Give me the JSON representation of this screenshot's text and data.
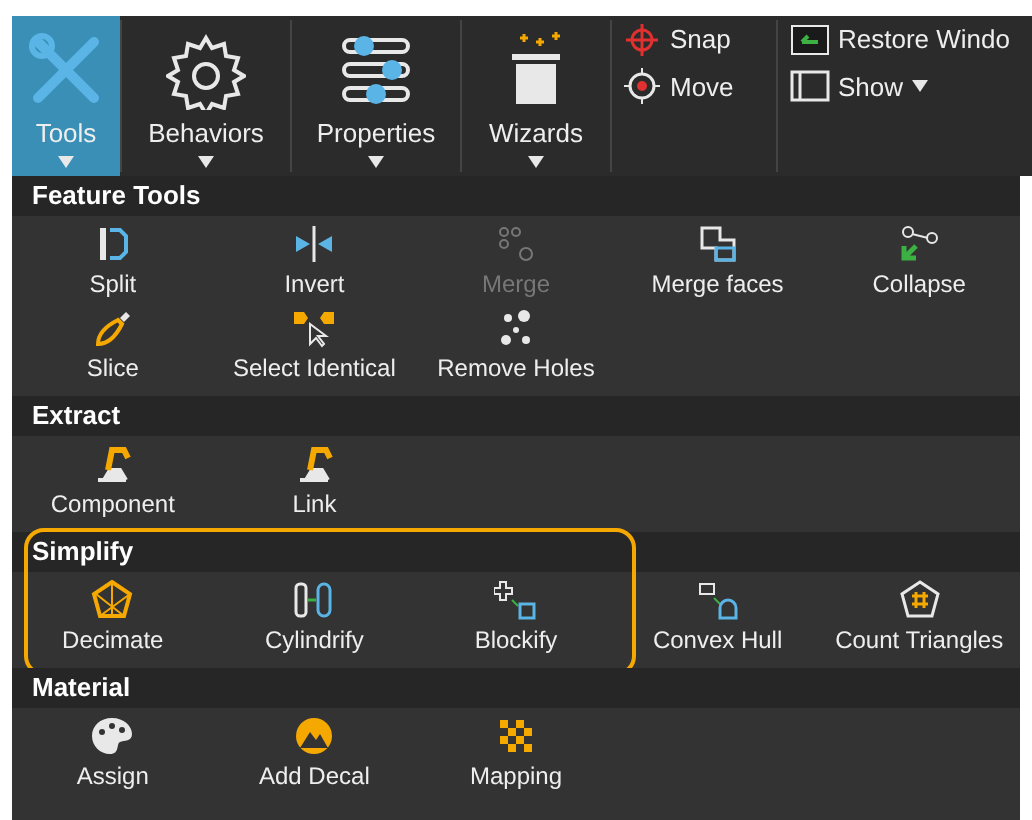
{
  "ribbon": {
    "large_buttons": [
      {
        "label": "Tools",
        "selected": true
      },
      {
        "label": "Behaviors",
        "selected": false
      },
      {
        "label": "Properties",
        "selected": false
      },
      {
        "label": "Wizards",
        "selected": false
      }
    ],
    "small_buttons": [
      {
        "label": "Snap",
        "kind": "plain"
      },
      {
        "label": "Move",
        "kind": "plain"
      },
      {
        "label": "Restore Windo",
        "kind": "plain"
      },
      {
        "label": "Show",
        "kind": "dropdown"
      }
    ]
  },
  "sections": [
    {
      "title": "Feature Tools",
      "items": [
        {
          "label": "Split",
          "disabled": false,
          "highlighted": false
        },
        {
          "label": "Invert",
          "disabled": false,
          "highlighted": false
        },
        {
          "label": "Merge",
          "disabled": true,
          "highlighted": false
        },
        {
          "label": "Merge faces",
          "disabled": false,
          "highlighted": false
        },
        {
          "label": "Collapse",
          "disabled": false,
          "highlighted": false
        },
        {
          "label": "Slice",
          "disabled": false,
          "highlighted": false
        },
        {
          "label": "Select Identical",
          "disabled": false,
          "highlighted": false
        },
        {
          "label": "Remove Holes",
          "disabled": false,
          "highlighted": false
        }
      ]
    },
    {
      "title": "Extract",
      "items": [
        {
          "label": "Component",
          "disabled": false,
          "highlighted": false
        },
        {
          "label": "Link",
          "disabled": false,
          "highlighted": false
        }
      ]
    },
    {
      "title": "Simplify",
      "items": [
        {
          "label": "Decimate",
          "disabled": false,
          "highlighted": true
        },
        {
          "label": "Cylindrify",
          "disabled": false,
          "highlighted": true
        },
        {
          "label": "Blockify",
          "disabled": false,
          "highlighted": true
        },
        {
          "label": "Convex Hull",
          "disabled": false,
          "highlighted": false
        },
        {
          "label": "Count Triangles",
          "disabled": false,
          "highlighted": false
        }
      ]
    },
    {
      "title": "Material",
      "items": [
        {
          "label": "Assign",
          "disabled": false,
          "highlighted": false
        },
        {
          "label": "Add Decal",
          "disabled": false,
          "highlighted": false
        },
        {
          "label": "Mapping",
          "disabled": false,
          "highlighted": false
        }
      ]
    }
  ]
}
